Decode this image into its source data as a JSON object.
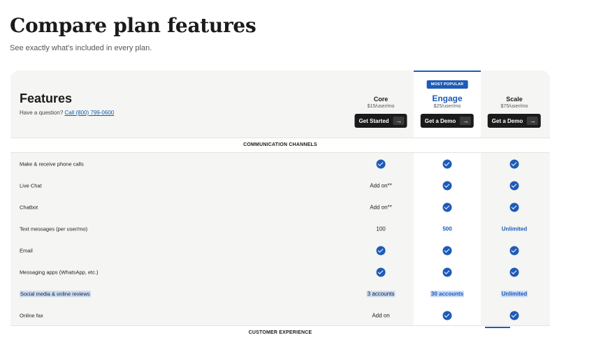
{
  "page": {
    "title": "Compare plan features",
    "subtitle": "See exactly what's included in every plan."
  },
  "header": {
    "features_label": "Features",
    "question_text": "Have a question? ",
    "call_link": "Call (800) 799-0600"
  },
  "plans": [
    {
      "name": "Core",
      "price": "$15/user/mo",
      "button": "Get Started",
      "popular": false
    },
    {
      "name": "Engage",
      "price": "$25/user/mo",
      "button": "Get a Demo",
      "popular": true,
      "badge": "MOST POPULAR"
    },
    {
      "name": "Scale",
      "price": "$75/user/mo",
      "button": "Get a Demo",
      "popular": false
    }
  ],
  "sections": [
    {
      "title": "COMMUNICATION CHANNELS",
      "rows": [
        {
          "label": "Make & receive phone calls",
          "core": "check",
          "engage": "check",
          "scale": "check"
        },
        {
          "label": "Live Chat",
          "core": "Add on**",
          "engage": "check",
          "scale": "check"
        },
        {
          "label": "Chatbot",
          "core": "Add on**",
          "engage": "check",
          "scale": "check"
        },
        {
          "label": "Text messages (per user/mo)",
          "core": "100",
          "engage": "500",
          "scale": "Unlimited"
        },
        {
          "label": "Email",
          "core": "check",
          "engage": "check",
          "scale": "check"
        },
        {
          "label": "Messaging apps (WhatsApp, etc.)",
          "core": "check",
          "engage": "check",
          "scale": "check"
        },
        {
          "label": "Social media & online reviews",
          "core": "3 accounts",
          "engage": "30 accounts",
          "scale": "Unlimited"
        },
        {
          "label": "Online fax",
          "core": "Add on",
          "engage": "check",
          "scale": "check"
        }
      ]
    },
    {
      "title": "CUSTOMER EXPERIENCE",
      "rows": []
    }
  ],
  "colors": {
    "accent": "#1e5bb8",
    "card_bg": "#f5f5f3",
    "highlight": "#c9dcf5"
  }
}
